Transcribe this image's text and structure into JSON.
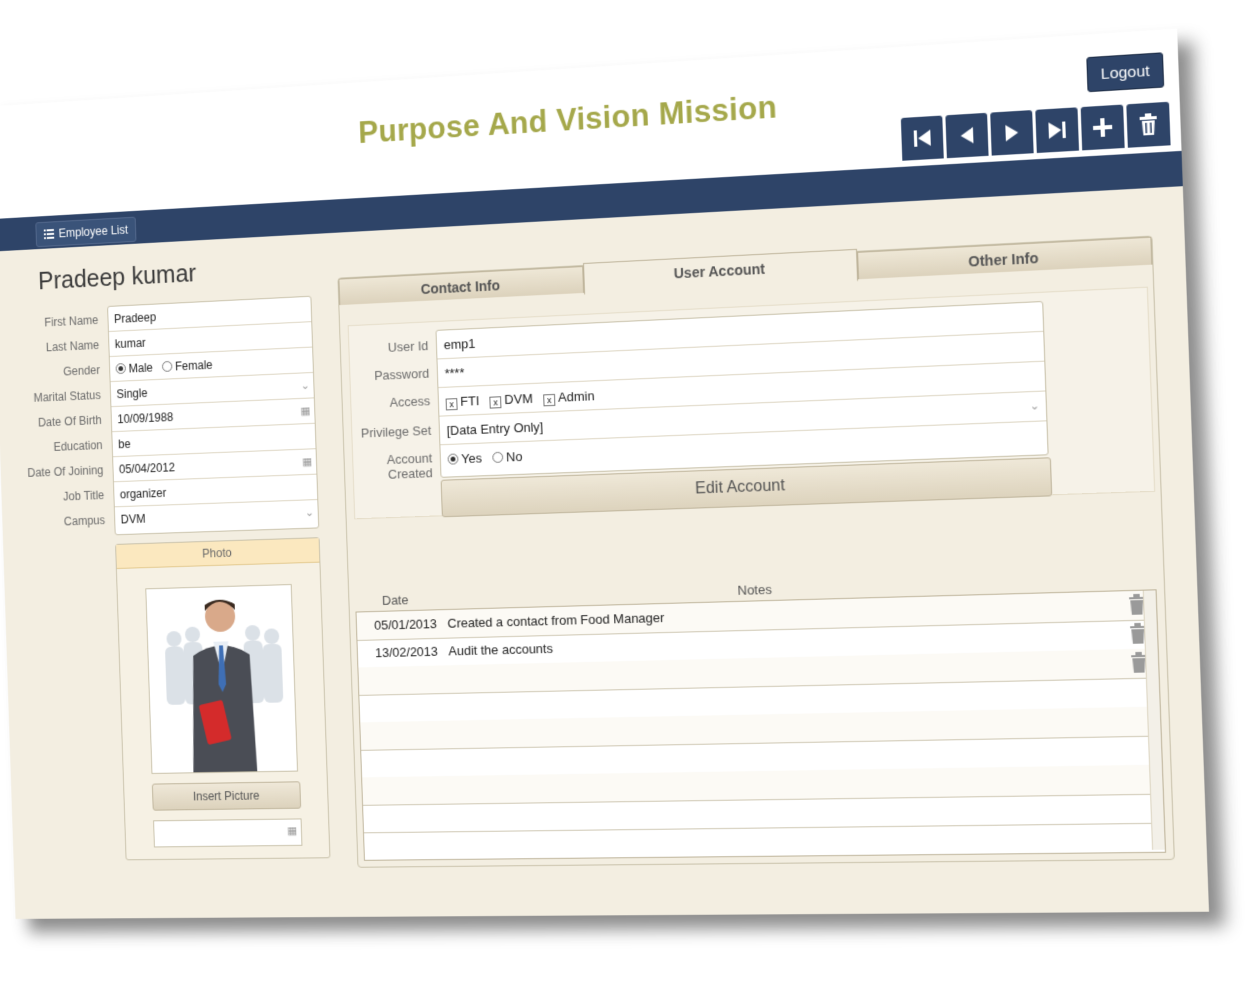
{
  "header": {
    "title": "Purpose And Vision Mission",
    "logout_label": "Logout",
    "nav_buttons": [
      "first-record-icon",
      "previous-record-icon",
      "next-record-icon",
      "last-record-icon",
      "add-record-icon",
      "delete-record-icon"
    ]
  },
  "navbar": {
    "employee_list_label": "Employee List"
  },
  "employee": {
    "full_name": "Pradeep kumar",
    "labels": {
      "first_name": "First Name",
      "last_name": "Last Name",
      "gender": "Gender",
      "marital_status": "Marital Status",
      "dob": "Date Of Birth",
      "education": "Education",
      "doj": "Date Of Joining",
      "job_title": "Job Title",
      "campus": "Campus"
    },
    "values": {
      "first_name": "Pradeep",
      "last_name": "kumar",
      "gender_male": "Male",
      "gender_female": "Female",
      "marital_status": "Single",
      "dob": "10/09/1988",
      "education": "be",
      "doj": "05/04/2012",
      "job_title": "organizer",
      "campus": "DVM"
    }
  },
  "photo": {
    "header": "Photo",
    "insert_label": "Insert Picture"
  },
  "tabs": {
    "contact": "Contact Info",
    "user_account": "User Account",
    "other": "Other Info"
  },
  "account": {
    "labels": {
      "user_id": "User Id",
      "password": "Password",
      "access": "Access",
      "privilege": "Privilege Set",
      "created": "Account Created"
    },
    "values": {
      "user_id": "emp1",
      "password": "****",
      "access_fti": "FTI",
      "access_dvm": "DVM",
      "access_admin": "Admin",
      "privilege": "[Data Entry Only]",
      "created_yes": "Yes",
      "created_no": "No"
    },
    "edit_label": "Edit Account"
  },
  "notes": {
    "header_date": "Date",
    "header_notes": "Notes",
    "rows": [
      {
        "date": "05/01/2013",
        "note": "Created a contact from Food Manager"
      },
      {
        "date": "13/02/2013",
        "note": "Audit the accounts"
      }
    ]
  }
}
